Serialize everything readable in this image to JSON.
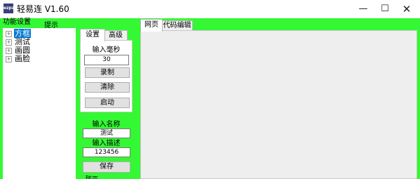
{
  "window": {
    "icon_text": "ezpz",
    "title": "轻易连 V1.60",
    "min_symbol": "—",
    "max_symbol": "☐",
    "close_symbol": "✕"
  },
  "groups": {
    "tools_title": "功能设置",
    "hint_title": "提示"
  },
  "tree": {
    "expander": "+",
    "items": [
      {
        "label": "方框",
        "selected": true
      },
      {
        "label": "测试",
        "selected": false
      },
      {
        "label": "画圆",
        "selected": false
      },
      {
        "label": "画脸",
        "selected": false
      }
    ]
  },
  "settings": {
    "tabs": [
      "设置",
      "高级"
    ],
    "ms_label": "输入毫秒",
    "ms_value": "30",
    "record_label": "录制",
    "clear_label": "清除",
    "start_label": "启动",
    "name_label": "输入名称",
    "name_value": "测试",
    "desc_label": "输入描述",
    "desc_value": "123456",
    "save_label": "保存",
    "bottom_hint": "提示"
  },
  "editor": {
    "tabs": [
      "网页",
      "代码编辑"
    ]
  },
  "colors": {
    "group_background": "#34f834",
    "selection": "#0078d7"
  }
}
